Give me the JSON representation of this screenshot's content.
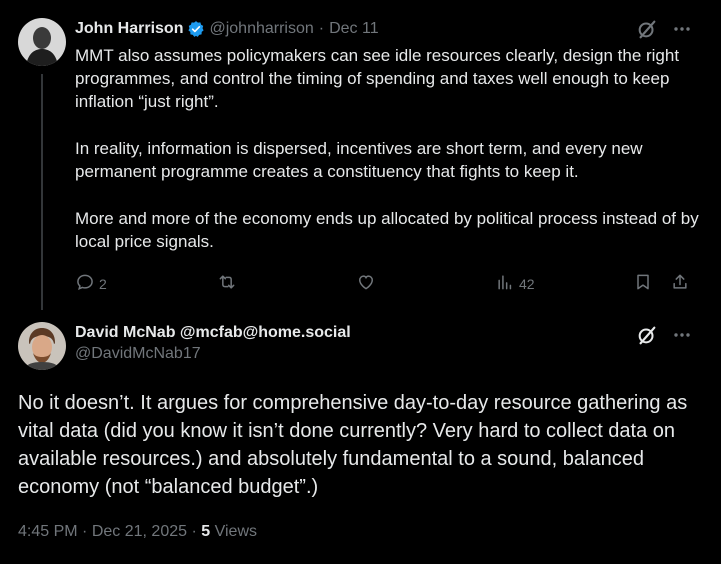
{
  "tweet1": {
    "name": "John Harrison",
    "handle": "@johnharrison",
    "separator": "·",
    "date": "Dec 11",
    "paragraphs": [
      "MMT also assumes policymakers can see idle resources clearly, design the right programmes, and control the timing of spending and taxes well enough to keep inflation “just right”.",
      "In reality, information is dispersed, incentives are short term, and every new permanent programme creates a constituency that fights to keep it.",
      "More and more of the economy ends up allocated by political process instead of by local price signals."
    ],
    "replies": "2",
    "views": "42"
  },
  "tweet2": {
    "name": "David McNab @mcfab@home.social",
    "handle": "@DavidMcNab17",
    "body": "No it doesn’t. It argues for comprehensive day-to-day resource gathering as vital data (did you know it isn’t done currently? Very hard to collect data on available resources.) and absolutely fundamental to a sound, balanced economy (not “balanced budget”.)",
    "time": "4:45 PM",
    "separator": "·",
    "date": "Dec 21, 2025",
    "views_count": "5",
    "views_label": "Views"
  },
  "colors": {
    "background": "#000000",
    "text": "#e7e9ea",
    "muted": "#71767b",
    "verified": "#1d9bf0",
    "thread_line": "#333639"
  },
  "icons": [
    "verified-badge-icon",
    "grok-icon",
    "more-icon",
    "reply-icon",
    "retweet-icon",
    "like-icon",
    "views-icon",
    "bookmark-icon",
    "share-icon"
  ]
}
